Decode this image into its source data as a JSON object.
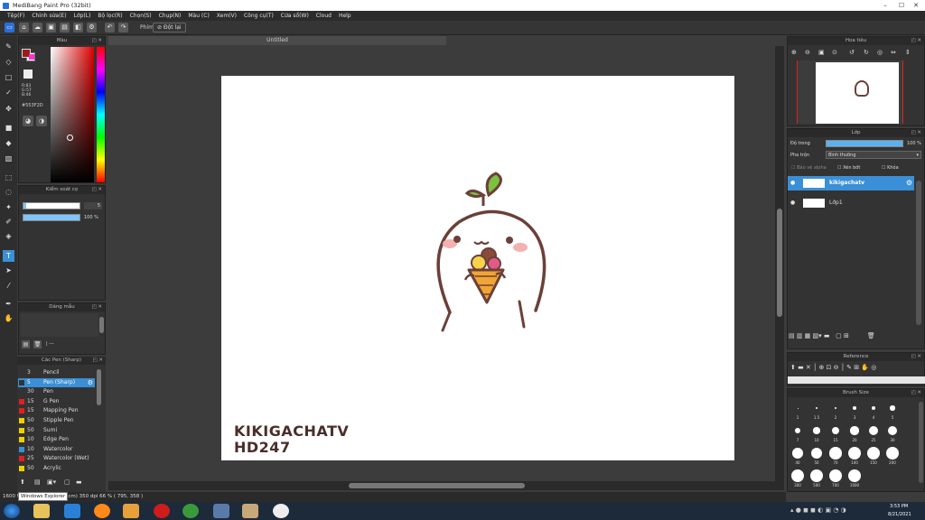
{
  "window": {
    "title": "MediBang Paint Pro (32bit)"
  },
  "menu": [
    "Tệp(F)",
    "Chỉnh sửa(E)",
    "Lớp(L)",
    "Bộ lọc(R)",
    "Chọn(S)",
    "Chụp(N)",
    "Màu (C)",
    "Xem(V)",
    "Công cụ(T)",
    "Cửa sổ(W)",
    "Cloud",
    "Help"
  ],
  "toolbar": {
    "label": "Phím",
    "option": "Đột lại"
  },
  "color_panel": {
    "title": "Màu",
    "r": "R:83",
    "g": "G:57",
    "b": "B:46",
    "hex": "#553F2D",
    "fg": "#9b1b1b",
    "bg": "#ffffff",
    "accent": "#ff33cc"
  },
  "brush_size_panel": {
    "title": "Kiểm soát cọ",
    "size": "5",
    "opacity": "100 %"
  },
  "brush_select_panel": {
    "title": "Dáng mẫu",
    "label": "| ---"
  },
  "brush_list": {
    "title": "Các Pen (Sharp)",
    "items": [
      {
        "size": "3",
        "name": "Pencil",
        "color": "#333333"
      },
      {
        "size": "5",
        "name": "Pen (Sharp)",
        "color": "#333333"
      },
      {
        "size": "30",
        "name": "Pen",
        "color": "#333333"
      },
      {
        "size": "15",
        "name": "G Pen",
        "color": "#e02020"
      },
      {
        "size": "15",
        "name": "Mapping Pen",
        "color": "#e02020"
      },
      {
        "size": "50",
        "name": "Stipple Pen",
        "color": "#f0d000"
      },
      {
        "size": "50",
        "name": "Sumi",
        "color": "#f0d000"
      },
      {
        "size": "10",
        "name": "Edge Pen",
        "color": "#f0d000"
      },
      {
        "size": "10",
        "name": "Watercolor",
        "color": "#3a8fd6"
      },
      {
        "size": "25",
        "name": "Watercolor (Wet)",
        "color": "#e02020"
      },
      {
        "size": "50",
        "name": "Acrylic",
        "color": "#f0d000"
      }
    ]
  },
  "document": {
    "tab": "Untitled",
    "watermark_line1": "KIKIGACHATV",
    "watermark_line2": "HD247"
  },
  "navigator": {
    "title": "Hoa tiêu"
  },
  "layer_panel": {
    "title": "Lớp",
    "opacity_label": "Độ trong",
    "opacity_value": "100 %",
    "blend_label": "Pha trộn",
    "blend_value": "Bình thường",
    "protect_alpha": "Bảo vệ alpha",
    "clipping": "Xén bớt",
    "lock": "Khóa",
    "layers": [
      {
        "name": "kikigachatv",
        "selected": true
      },
      {
        "name": "Lớp1",
        "selected": false
      }
    ]
  },
  "reference": {
    "title": "Reference"
  },
  "brush_size_grid": {
    "title": "Brush Size",
    "sizes": [
      "1",
      "1.5",
      "2",
      "3",
      "4",
      "5",
      "7",
      "10",
      "15",
      "20",
      "25",
      "30",
      "40",
      "50",
      "70",
      "100",
      "150",
      "200",
      "300",
      "500",
      "700",
      "1000"
    ]
  },
  "status": {
    "text": "1600   Windows Explorer  (7cm)  350 dpi  66 %  ( 795, 358 )",
    "tooltip": "Windows Explorer"
  },
  "clock": {
    "time": "3:53 PM",
    "date": "8/21/2021"
  }
}
